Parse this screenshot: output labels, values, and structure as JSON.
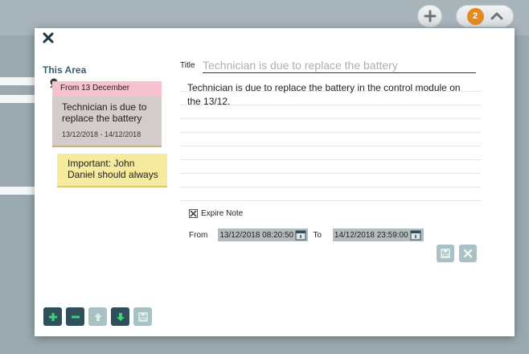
{
  "topbar": {
    "add_icon": "plus-icon",
    "notification_count": "2",
    "collapse_icon": "chevron-up-icon"
  },
  "modal": {
    "close_icon": "close-icon",
    "area_title": "This Area",
    "notes": [
      {
        "head": "From 13 December",
        "body": "Technician is due to replace the battery",
        "dates": "13/12/2018 - 14/12/2018",
        "color": "#d3ccca",
        "head_color": "#f6c2cf"
      },
      {
        "body": "Important: John Daniel should always",
        "color": "#f5ea9e"
      }
    ],
    "toolbar": [
      "add",
      "remove",
      "move-up",
      "move-down",
      "save"
    ],
    "editor": {
      "title_label": "Title",
      "title_placeholder": "Technician is due to replace the battery",
      "content": "Technician is due to replace the battery in the control module on the 13/12.",
      "expire_label": "Expire Note",
      "expire_checked": true,
      "from_label": "From",
      "from_value": "13/12/2018 08:20:50",
      "to_label": "To",
      "to_value": "14/12/2018 23:59:00"
    }
  },
  "colors": {
    "accent": "#356070",
    "dark_button": "#2f4f5a",
    "disabled_button": "#a9c0c4",
    "badge": "#e58a1f"
  }
}
